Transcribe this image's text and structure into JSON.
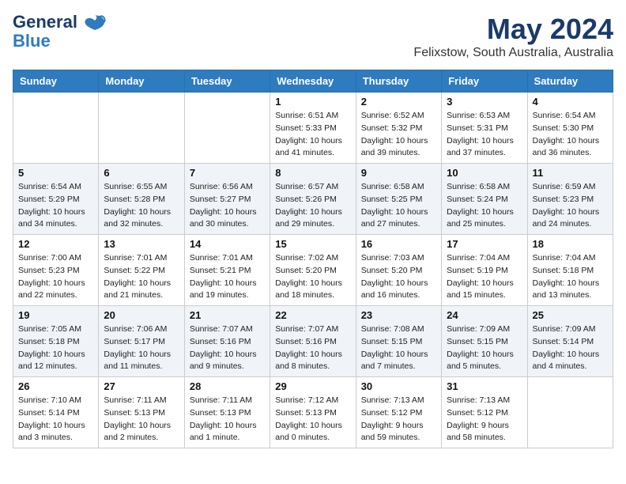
{
  "logo": {
    "line1": "General",
    "line2": "Blue"
  },
  "title": "May 2024",
  "subtitle": "Felixstow, South Australia, Australia",
  "days_of_week": [
    "Sunday",
    "Monday",
    "Tuesday",
    "Wednesday",
    "Thursday",
    "Friday",
    "Saturday"
  ],
  "weeks": [
    [
      {
        "day": "",
        "info": ""
      },
      {
        "day": "",
        "info": ""
      },
      {
        "day": "",
        "info": ""
      },
      {
        "day": "1",
        "info": "Sunrise: 6:51 AM\nSunset: 5:33 PM\nDaylight: 10 hours\nand 41 minutes."
      },
      {
        "day": "2",
        "info": "Sunrise: 6:52 AM\nSunset: 5:32 PM\nDaylight: 10 hours\nand 39 minutes."
      },
      {
        "day": "3",
        "info": "Sunrise: 6:53 AM\nSunset: 5:31 PM\nDaylight: 10 hours\nand 37 minutes."
      },
      {
        "day": "4",
        "info": "Sunrise: 6:54 AM\nSunset: 5:30 PM\nDaylight: 10 hours\nand 36 minutes."
      }
    ],
    [
      {
        "day": "5",
        "info": "Sunrise: 6:54 AM\nSunset: 5:29 PM\nDaylight: 10 hours\nand 34 minutes."
      },
      {
        "day": "6",
        "info": "Sunrise: 6:55 AM\nSunset: 5:28 PM\nDaylight: 10 hours\nand 32 minutes."
      },
      {
        "day": "7",
        "info": "Sunrise: 6:56 AM\nSunset: 5:27 PM\nDaylight: 10 hours\nand 30 minutes."
      },
      {
        "day": "8",
        "info": "Sunrise: 6:57 AM\nSunset: 5:26 PM\nDaylight: 10 hours\nand 29 minutes."
      },
      {
        "day": "9",
        "info": "Sunrise: 6:58 AM\nSunset: 5:25 PM\nDaylight: 10 hours\nand 27 minutes."
      },
      {
        "day": "10",
        "info": "Sunrise: 6:58 AM\nSunset: 5:24 PM\nDaylight: 10 hours\nand 25 minutes."
      },
      {
        "day": "11",
        "info": "Sunrise: 6:59 AM\nSunset: 5:23 PM\nDaylight: 10 hours\nand 24 minutes."
      }
    ],
    [
      {
        "day": "12",
        "info": "Sunrise: 7:00 AM\nSunset: 5:23 PM\nDaylight: 10 hours\nand 22 minutes."
      },
      {
        "day": "13",
        "info": "Sunrise: 7:01 AM\nSunset: 5:22 PM\nDaylight: 10 hours\nand 21 minutes."
      },
      {
        "day": "14",
        "info": "Sunrise: 7:01 AM\nSunset: 5:21 PM\nDaylight: 10 hours\nand 19 minutes."
      },
      {
        "day": "15",
        "info": "Sunrise: 7:02 AM\nSunset: 5:20 PM\nDaylight: 10 hours\nand 18 minutes."
      },
      {
        "day": "16",
        "info": "Sunrise: 7:03 AM\nSunset: 5:20 PM\nDaylight: 10 hours\nand 16 minutes."
      },
      {
        "day": "17",
        "info": "Sunrise: 7:04 AM\nSunset: 5:19 PM\nDaylight: 10 hours\nand 15 minutes."
      },
      {
        "day": "18",
        "info": "Sunrise: 7:04 AM\nSunset: 5:18 PM\nDaylight: 10 hours\nand 13 minutes."
      }
    ],
    [
      {
        "day": "19",
        "info": "Sunrise: 7:05 AM\nSunset: 5:18 PM\nDaylight: 10 hours\nand 12 minutes."
      },
      {
        "day": "20",
        "info": "Sunrise: 7:06 AM\nSunset: 5:17 PM\nDaylight: 10 hours\nand 11 minutes."
      },
      {
        "day": "21",
        "info": "Sunrise: 7:07 AM\nSunset: 5:16 PM\nDaylight: 10 hours\nand 9 minutes."
      },
      {
        "day": "22",
        "info": "Sunrise: 7:07 AM\nSunset: 5:16 PM\nDaylight: 10 hours\nand 8 minutes."
      },
      {
        "day": "23",
        "info": "Sunrise: 7:08 AM\nSunset: 5:15 PM\nDaylight: 10 hours\nand 7 minutes."
      },
      {
        "day": "24",
        "info": "Sunrise: 7:09 AM\nSunset: 5:15 PM\nDaylight: 10 hours\nand 5 minutes."
      },
      {
        "day": "25",
        "info": "Sunrise: 7:09 AM\nSunset: 5:14 PM\nDaylight: 10 hours\nand 4 minutes."
      }
    ],
    [
      {
        "day": "26",
        "info": "Sunrise: 7:10 AM\nSunset: 5:14 PM\nDaylight: 10 hours\nand 3 minutes."
      },
      {
        "day": "27",
        "info": "Sunrise: 7:11 AM\nSunset: 5:13 PM\nDaylight: 10 hours\nand 2 minutes."
      },
      {
        "day": "28",
        "info": "Sunrise: 7:11 AM\nSunset: 5:13 PM\nDaylight: 10 hours\nand 1 minute."
      },
      {
        "day": "29",
        "info": "Sunrise: 7:12 AM\nSunset: 5:13 PM\nDaylight: 10 hours\nand 0 minutes."
      },
      {
        "day": "30",
        "info": "Sunrise: 7:13 AM\nSunset: 5:12 PM\nDaylight: 9 hours\nand 59 minutes."
      },
      {
        "day": "31",
        "info": "Sunrise: 7:13 AM\nSunset: 5:12 PM\nDaylight: 9 hours\nand 58 minutes."
      },
      {
        "day": "",
        "info": ""
      }
    ]
  ]
}
